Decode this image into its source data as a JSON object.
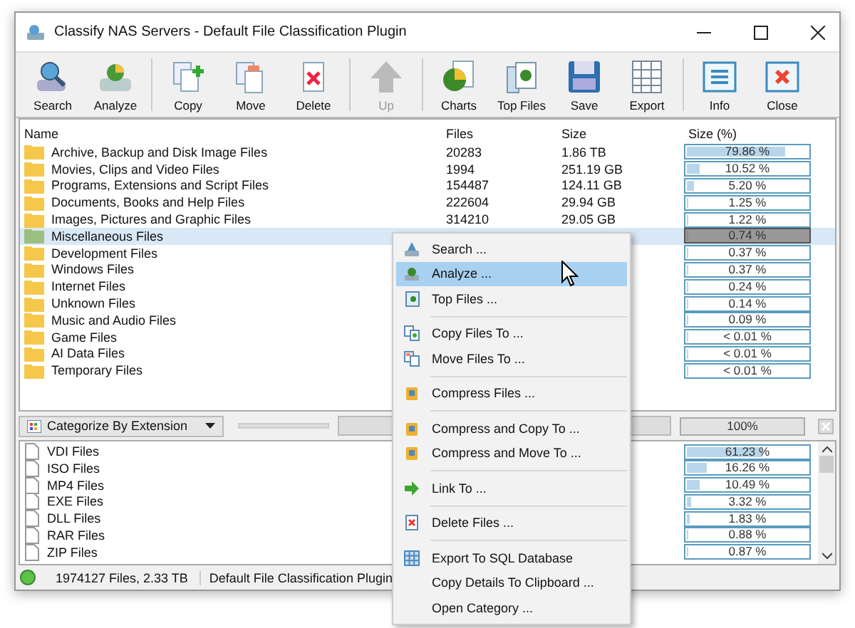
{
  "window": {
    "title": "Classify NAS Servers - Default File Classification Plugin"
  },
  "toolbar": [
    [
      {
        "label": "Search",
        "disabled": false
      },
      {
        "label": "Analyze",
        "disabled": false
      }
    ],
    [
      {
        "label": "Copy",
        "disabled": false
      },
      {
        "label": "Move",
        "disabled": false
      },
      {
        "label": "Delete",
        "disabled": false
      }
    ],
    [
      {
        "label": "Up",
        "disabled": true
      }
    ],
    [
      {
        "label": "Charts",
        "disabled": false
      },
      {
        "label": "Top Files",
        "disabled": false
      },
      {
        "label": "Save",
        "disabled": false
      },
      {
        "label": "Export",
        "disabled": false
      }
    ],
    [
      {
        "label": "Info",
        "disabled": false
      },
      {
        "label": "Close",
        "disabled": false
      }
    ]
  ],
  "table": {
    "columns": [
      "Name",
      "Files",
      "Size",
      "Size (%)"
    ],
    "rows": [
      {
        "name": "Archive, Backup and Disk Image Files",
        "files": "20283",
        "size": "1.86 TB",
        "percent": "79.86 %",
        "level": 0.7986,
        "selected": false
      },
      {
        "name": "Movies, Clips and Video Files",
        "files": "1994",
        "size": "251.19 GB",
        "percent": "10.52 %",
        "level": 0.1052,
        "selected": false
      },
      {
        "name": "Programs, Extensions and Script Files",
        "files": "154487",
        "size": "124.11 GB",
        "percent": "5.20 %",
        "level": 0.052,
        "selected": false
      },
      {
        "name": "Documents, Books and Help Files",
        "files": "222604",
        "size": "29.94 GB",
        "percent": "1.25 %",
        "level": 0.0125,
        "selected": false
      },
      {
        "name": "Images, Pictures and Graphic Files",
        "files": "314210",
        "size": "29.05 GB",
        "percent": "1.22 %",
        "level": 0.0122,
        "selected": false
      },
      {
        "name": "Miscellaneous Files",
        "percent": "0.74 %",
        "level": 0.0074,
        "selected": true
      },
      {
        "name": "Development Files",
        "percent": "0.37 %",
        "level": 0.0037,
        "selected": false
      },
      {
        "name": "Windows Files",
        "percent": "0.37 %",
        "level": 0.0037,
        "selected": false
      },
      {
        "name": "Internet Files",
        "percent": "0.24 %",
        "level": 0.0024,
        "selected": false
      },
      {
        "name": "Unknown Files",
        "percent": "0.14 %",
        "level": 0.0014,
        "selected": false
      },
      {
        "name": "Music and Audio Files",
        "percent": "0.09 %",
        "level": 0.0009,
        "selected": false
      },
      {
        "name": "Game Files",
        "percent": "< 0.01 %",
        "level": 0.0,
        "selected": false
      },
      {
        "name": "AI Data Files",
        "percent": "< 0.01 %",
        "level": 0.0,
        "selected": false
      },
      {
        "name": "Temporary Files",
        "percent": "< 0.01 %",
        "level": 0.0,
        "selected": false
      }
    ]
  },
  "categorize": {
    "value": "Categorize By Extension",
    "progress": {
      "label": "100%",
      "level": 1
    }
  },
  "extensions": [
    {
      "name": "VDI Files",
      "percent": "61.23 %",
      "level": 0.6123
    },
    {
      "name": "ISO Files",
      "percent": "16.26 %",
      "level": 0.1626
    },
    {
      "name": "MP4 Files",
      "percent": "10.49 %",
      "level": 0.1049
    },
    {
      "name": "EXE Files",
      "percent": "3.32 %",
      "level": 0.0332
    },
    {
      "name": "DLL Files",
      "percent": "1.83 %",
      "level": 0.0183
    },
    {
      "name": "RAR Files",
      "percent": "0.88 %",
      "level": 0.0088
    },
    {
      "name": "ZIP Files",
      "percent": "0.87 %",
      "level": 0.0087
    }
  ],
  "status_bar": {
    "summary": "1974127 Files, 2.33 TB",
    "plugin": "Default File Classification Plugin"
  },
  "context_menu": [
    [
      {
        "label": "Search ...",
        "selected": false
      },
      {
        "label": "Analyze ...",
        "selected": true
      },
      {
        "label": "Top Files ...",
        "selected": false
      }
    ],
    [
      {
        "label": "Copy Files To ...",
        "selected": false
      },
      {
        "label": "Move Files To ...",
        "selected": false
      }
    ],
    [
      {
        "label": "Compress Files ...",
        "selected": false
      }
    ],
    [
      {
        "label": "Compress and Copy To ...",
        "selected": false
      },
      {
        "label": "Compress and Move To ...",
        "selected": false
      }
    ],
    [
      {
        "label": "Link To ...",
        "selected": false
      }
    ],
    [
      {
        "label": "Delete Files ...",
        "selected": false
      }
    ],
    [
      {
        "label": "Export To SQL Database",
        "selected": false
      },
      {
        "label": "Copy Details To Clipboard ...",
        "selected": false
      },
      {
        "label": "Open Category ...",
        "selected": false
      }
    ]
  ]
}
